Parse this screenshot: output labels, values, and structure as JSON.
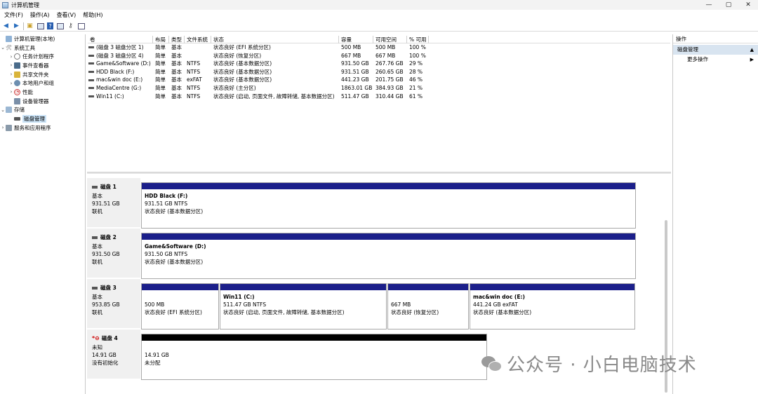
{
  "window": {
    "title": "计算机管理",
    "controls": [
      "—",
      "▢",
      "✕"
    ]
  },
  "menubar": {
    "items": [
      "文件(F)",
      "操作(A)",
      "查看(V)",
      "帮助(H)"
    ]
  },
  "tree": {
    "root": "计算机管理(本地)",
    "system_tools": "系统工具",
    "task_scheduler": "任务计划程序",
    "event_viewer": "事件查看器",
    "shared_folders": "共享文件夹",
    "local_users": "本地用户和组",
    "performance": "性能",
    "device_manager": "设备管理器",
    "storage": "存储",
    "disk_management": "磁盘管理",
    "services": "服务和应用程序"
  },
  "volumes": {
    "headers": [
      "卷",
      "布局",
      "类型",
      "文件系统",
      "状态",
      "容量",
      "可用空间",
      "% 可用"
    ],
    "rows": [
      {
        "name": "(磁盘 3 磁盘分区 1)",
        "layout": "简单",
        "type": "基本",
        "fs": "",
        "status": "状态良好 (EFI 系统分区)",
        "capacity": "500 MB",
        "free": "500 MB",
        "pct": "100 %"
      },
      {
        "name": "(磁盘 3 磁盘分区 4)",
        "layout": "简单",
        "type": "基本",
        "fs": "",
        "status": "状态良好 (恢复分区)",
        "capacity": "667 MB",
        "free": "667 MB",
        "pct": "100 %"
      },
      {
        "name": "Game&Software (D:)",
        "layout": "简单",
        "type": "基本",
        "fs": "NTFS",
        "status": "状态良好 (基本数据分区)",
        "capacity": "931.50 GB",
        "free": "267.76 GB",
        "pct": "29 %"
      },
      {
        "name": "HDD Black (F:)",
        "layout": "简单",
        "type": "基本",
        "fs": "NTFS",
        "status": "状态良好 (基本数据分区)",
        "capacity": "931.51 GB",
        "free": "260.65 GB",
        "pct": "28 %"
      },
      {
        "name": "mac&win doc (E:)",
        "layout": "简单",
        "type": "基本",
        "fs": "exFAT",
        "status": "状态良好 (基本数据分区)",
        "capacity": "441.23 GB",
        "free": "201.75 GB",
        "pct": "46 %"
      },
      {
        "name": "MediaCentre (G:)",
        "layout": "简单",
        "type": "基本",
        "fs": "NTFS",
        "status": "状态良好 (主分区)",
        "capacity": "1863.01 GB",
        "free": "384.93 GB",
        "pct": "21 %"
      },
      {
        "name": "Win11 (C:)",
        "layout": "简单",
        "type": "基本",
        "fs": "NTFS",
        "status": "状态良好 (启动, 页面文件, 故障转储, 基本数据分区)",
        "capacity": "511.47 GB",
        "free": "310.44 GB",
        "pct": "61 %"
      }
    ]
  },
  "disks": [
    {
      "name": "磁盘 1",
      "kind": "基本",
      "size": "931.51 GB",
      "state": "联机",
      "partitions": [
        {
          "name": "HDD Black  (F:)",
          "size": "931.51 GB NTFS",
          "status": "状态良好 (基本数据分区)",
          "fill": 1.0
        }
      ]
    },
    {
      "name": "磁盘 2",
      "kind": "基本",
      "size": "931.50 GB",
      "state": "联机",
      "partitions": [
        {
          "name": "Game&Software  (D:)",
          "size": "931.50 GB NTFS",
          "status": "状态良好 (基本数据分区)",
          "fill": 1.0
        }
      ]
    },
    {
      "name": "磁盘 3",
      "kind": "基本",
      "size": "953.85 GB",
      "state": "联机",
      "partitions": [
        {
          "name": "",
          "size": "500 MB",
          "status": "状态良好 (EFI 系统分区)"
        },
        {
          "name": "Win11  (C:)",
          "size": "511.47 GB NTFS",
          "status": "状态良好 (启动, 页面文件, 故障转储, 基本数据分区)"
        },
        {
          "name": "",
          "size": "667 MB",
          "status": "状态良好 (恢复分区)"
        },
        {
          "name": "mac&win doc  (E:)",
          "size": "441.24 GB exFAT",
          "status": "状态良好 (基本数据分区)"
        }
      ]
    },
    {
      "name": "磁盘 4",
      "kind": "未知",
      "size": "14.91 GB",
      "state": "没有初始化",
      "partitions": [
        {
          "name": "",
          "size": "14.91 GB",
          "status": "未分配"
        }
      ]
    }
  ],
  "actions": {
    "header": "操作",
    "section": "磁盘管理",
    "more": "更多操作"
  },
  "watermark": {
    "text": "公众号 · 小白电脑技术"
  },
  "colors": {
    "partition_bar": "#1b1f8a",
    "unallocated_bar": "#000000",
    "selection": "#cce4f7"
  }
}
